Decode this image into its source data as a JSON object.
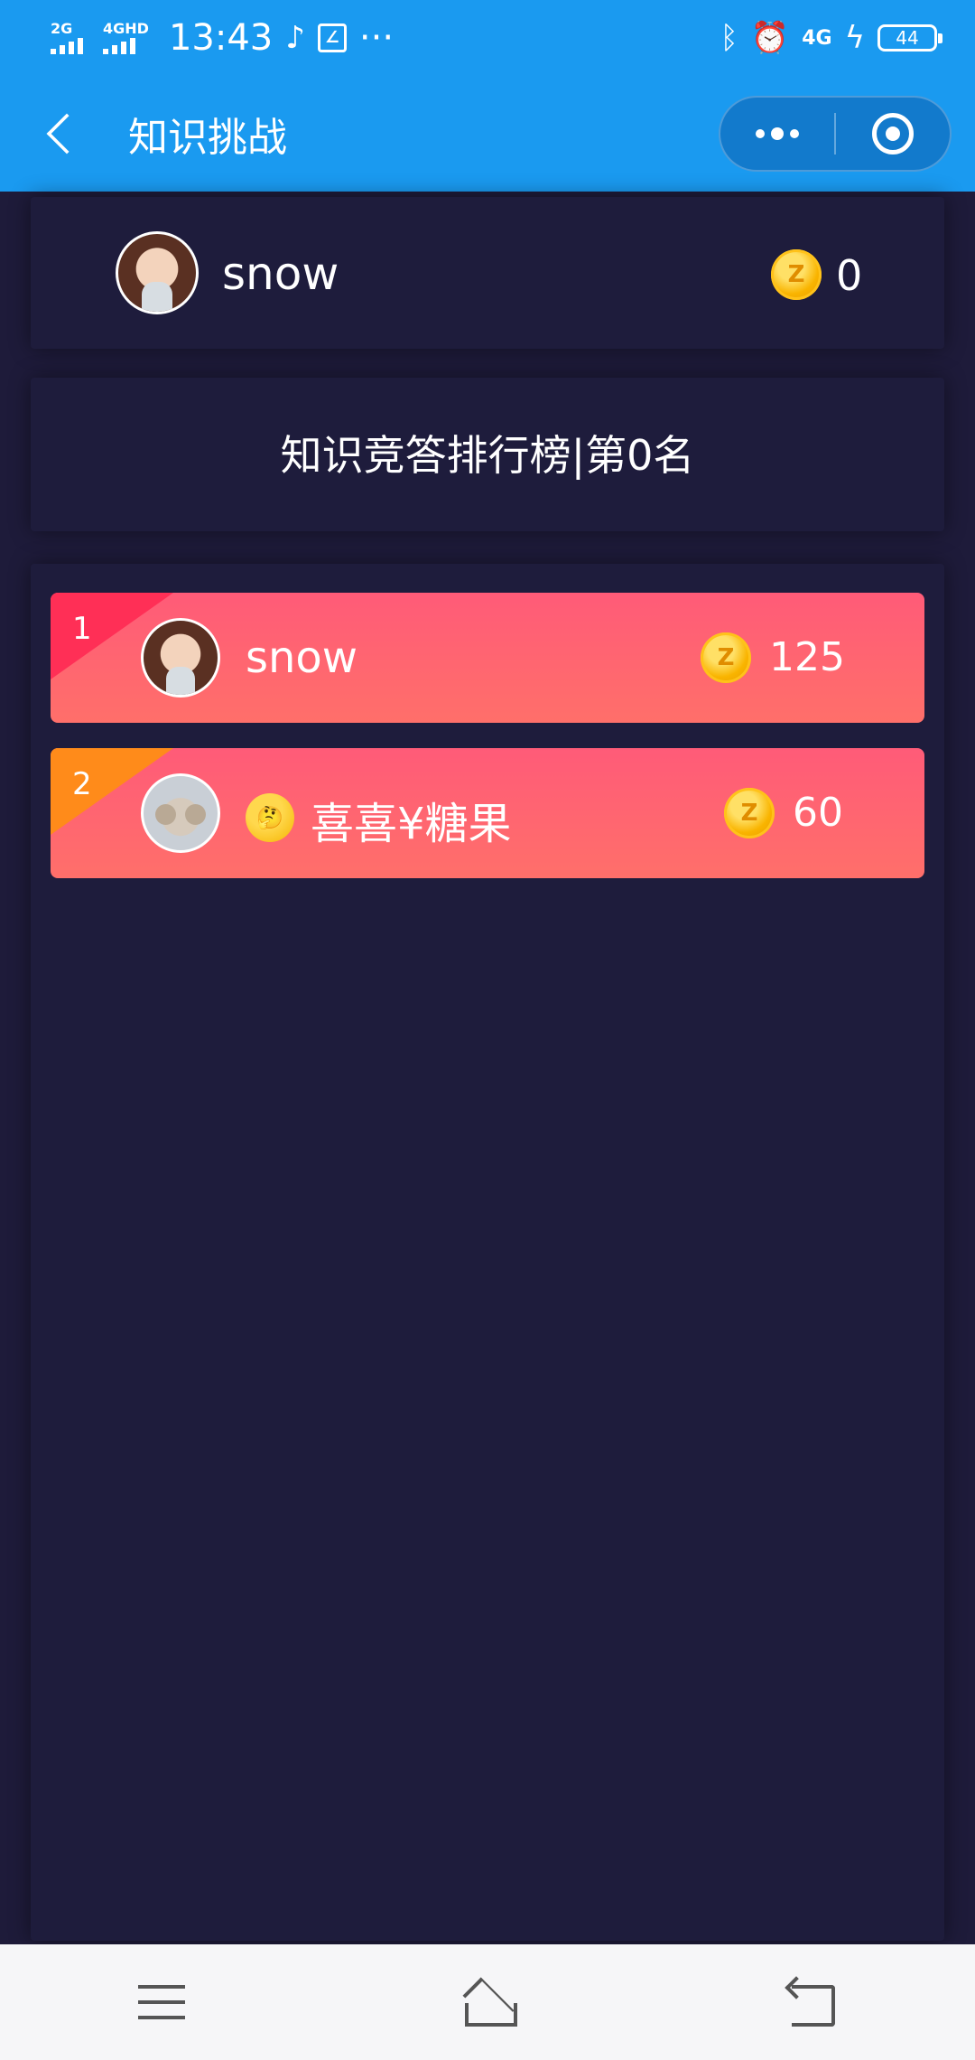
{
  "status_bar": {
    "signal_1_label": "2G",
    "signal_2_label": "4GHD",
    "time": "13:43",
    "more": "···",
    "network_right": "4G",
    "battery": "44"
  },
  "nav": {
    "title": "知识挑战"
  },
  "user": {
    "name": "snow",
    "coins": "0"
  },
  "rank_header": {
    "title": "知识竞答排行榜|第0名"
  },
  "leaderboard": [
    {
      "rank": "1",
      "emoji": "",
      "name": "snow",
      "score": "125"
    },
    {
      "rank": "2",
      "emoji": "🤔",
      "name": "喜喜¥糖果",
      "score": "60"
    }
  ],
  "icons": {
    "coin": "Z"
  },
  "colors": {
    "primary": "#1a9af0",
    "background": "#1e1b3a",
    "row_gradient_top": "#ff5b78",
    "row_gradient_bottom": "#ff6f6a",
    "rank1_ribbon": "#ff2f56",
    "rank2_ribbon": "#ff8b1a",
    "coin": "#f9b400"
  }
}
